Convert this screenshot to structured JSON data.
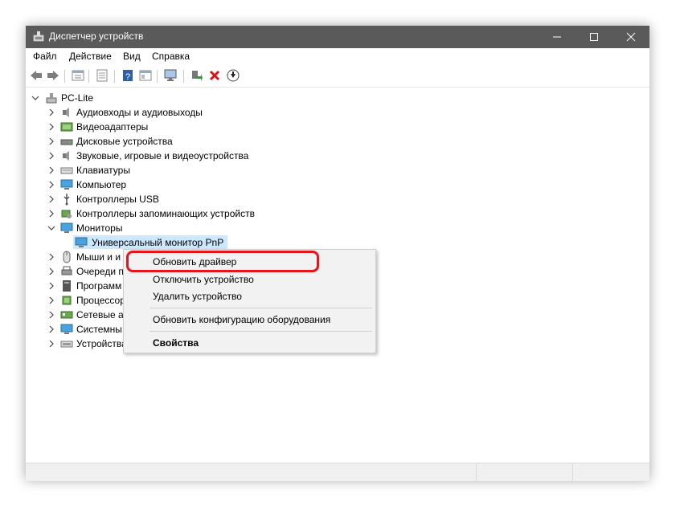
{
  "window": {
    "title": "Диспетчер устройств",
    "controls": [
      "minimize",
      "maximize",
      "close"
    ]
  },
  "menu": [
    "Файл",
    "Действие",
    "Вид",
    "Справка"
  ],
  "toolbar": {
    "buttons": [
      "back-icon",
      "forward-icon",
      "properties-icon",
      "grid-icon",
      "help-icon",
      "view-icon",
      "monitor-scan-icon",
      "update-driver-icon",
      "uninstall-icon",
      "download-icon"
    ]
  },
  "tree": {
    "root": "PC-Lite",
    "categories": [
      {
        "label": "Аудиовходы и аудиовыходы",
        "icon": "audio-icon"
      },
      {
        "label": "Видеоадаптеры",
        "icon": "display-adapter-icon"
      },
      {
        "label": "Дисковые устройства",
        "icon": "disk-icon"
      },
      {
        "label": "Звуковые, игровые и видеоустройства",
        "icon": "sound-icon"
      },
      {
        "label": "Клавиатуры",
        "icon": "keyboard-icon"
      },
      {
        "label": "Компьютер",
        "icon": "computer-icon"
      },
      {
        "label": "Контроллеры USB",
        "icon": "usb-icon"
      },
      {
        "label": "Контроллеры запоминающих устройств",
        "icon": "storage-controller-icon"
      },
      {
        "label": "Мониторы",
        "icon": "monitor-icon",
        "expanded": true
      },
      {
        "label": "Мыши и и",
        "icon": "mouse-icon"
      },
      {
        "label": "Очереди п",
        "icon": "print-queue-icon"
      },
      {
        "label": "Программ",
        "icon": "software-device-icon"
      },
      {
        "label": "Процессор",
        "icon": "processor-icon"
      },
      {
        "label": "Сетевые ад",
        "icon": "network-icon"
      },
      {
        "label": "Системны",
        "icon": "system-icon"
      },
      {
        "label": "Устройства",
        "icon": "hid-icon"
      }
    ],
    "selected_child": "Универсальный монитор PnP"
  },
  "context_menu": {
    "items": [
      {
        "label": "Обновить драйвер",
        "highlighted": true
      },
      {
        "label": "Отключить устройство"
      },
      {
        "label": "Удалить устройство"
      },
      {
        "label": "Обновить конфигурацию оборудования"
      },
      {
        "label": "Свойства",
        "bold": true
      }
    ]
  },
  "colors": {
    "titlebar": "#5a5a5a",
    "selection": "#cce8ff",
    "highlight_ring": "#e8141b"
  }
}
